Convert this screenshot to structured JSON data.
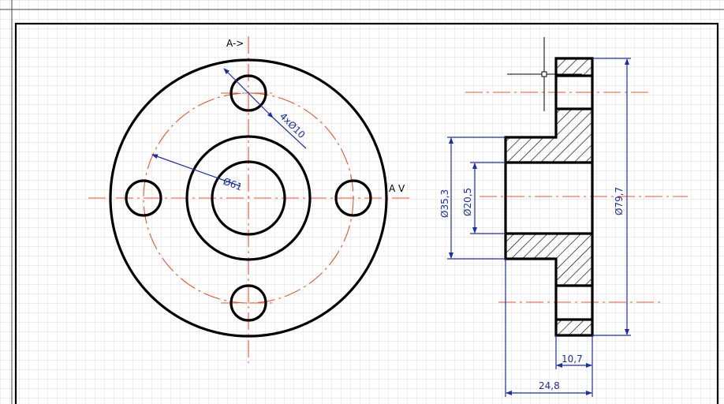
{
  "drawing": {
    "section_label_top": "A->",
    "section_label_right": "A V",
    "dimensions": {
      "bolt_holes": "4xØ10",
      "pitch_circle": "Ø61",
      "inner_bore": "Ø20,5",
      "hub_diameter": "Ø35,3",
      "outer_diameter": "Ø79,7",
      "flange_thickness": "10,7",
      "total_length": "24,8"
    }
  },
  "colors": {
    "outline": "#000000",
    "centerline": "#e8542b",
    "dimension": "#1a2ea8",
    "grid_minor": "#c8c8c8",
    "grid_major": "#a0a0a0"
  }
}
